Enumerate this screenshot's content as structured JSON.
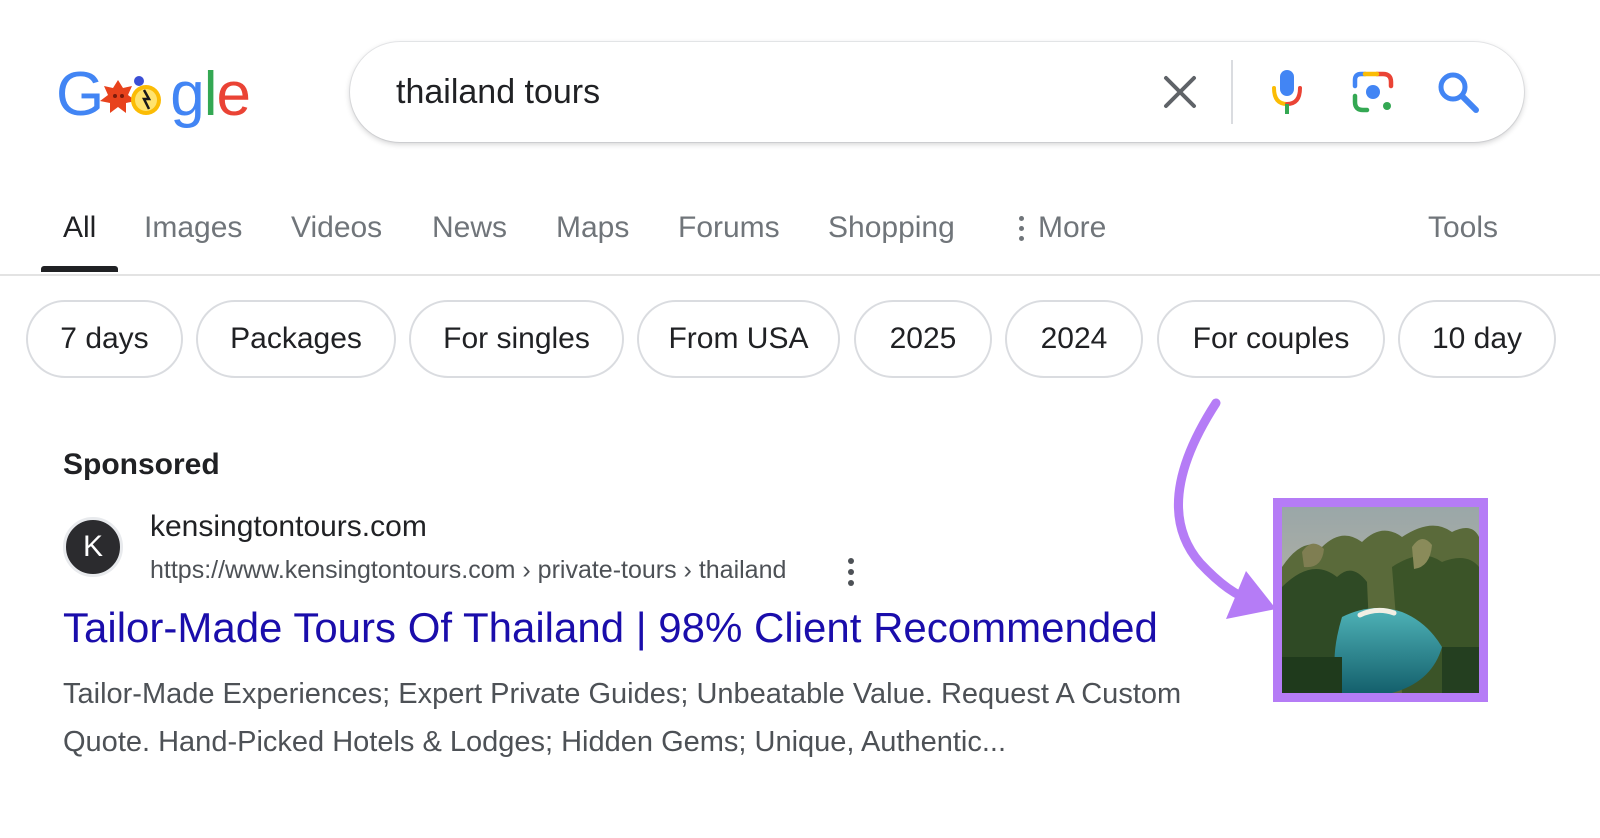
{
  "logo": {
    "alt": "Google",
    "letters": [
      "G",
      "o",
      "o",
      "g",
      "l",
      "e"
    ]
  },
  "search": {
    "query": "thailand tours"
  },
  "tabs": [
    {
      "label": "All",
      "active": true
    },
    {
      "label": "Images"
    },
    {
      "label": "Videos"
    },
    {
      "label": "News"
    },
    {
      "label": "Maps"
    },
    {
      "label": "Forums"
    },
    {
      "label": "Shopping"
    },
    {
      "label": "More"
    },
    {
      "label": "Tools"
    }
  ],
  "chips": [
    "7 days",
    "Packages",
    "For singles",
    "From USA",
    "2025",
    "2024",
    "For couples",
    "10 day"
  ],
  "ad": {
    "sponsored_label": "Sponsored",
    "favicon_letter": "K",
    "site_name": "kensingtontours.com",
    "url": "https://www.kensingtontours.com › private-tours › thailand",
    "title": "Tailor-Made Tours Of Thailand | 98% Client Recommended",
    "description_line1": "Tailor-Made Experiences; Expert Private Guides; Unbeatable Value. Request A Custom",
    "description_line2": "Quote. Hand-Picked Hotels & Lodges; Hidden Gems; Unique, Authentic..."
  },
  "colors": {
    "link": "#1a0dab",
    "highlight": "#b57cf6",
    "google_blue": "#4285f4",
    "google_red": "#ea4335",
    "google_yellow": "#fbbc05",
    "google_green": "#34a853"
  },
  "icons": [
    "clear-icon",
    "mic-icon",
    "lens-icon",
    "search-icon",
    "more-dots-icon",
    "kebab-icon"
  ]
}
